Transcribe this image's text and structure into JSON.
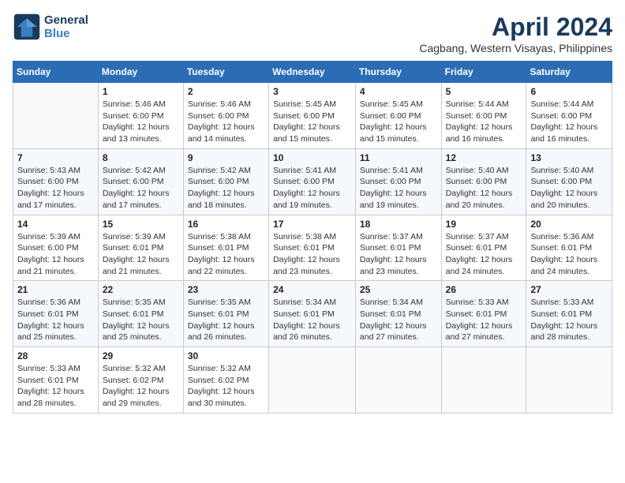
{
  "header": {
    "logo_line1": "General",
    "logo_line2": "Blue",
    "month_year": "April 2024",
    "location": "Cagbang, Western Visayas, Philippines"
  },
  "weekdays": [
    "Sunday",
    "Monday",
    "Tuesday",
    "Wednesday",
    "Thursday",
    "Friday",
    "Saturday"
  ],
  "weeks": [
    [
      {
        "day": "",
        "info": ""
      },
      {
        "day": "1",
        "info": "Sunrise: 5:46 AM\nSunset: 6:00 PM\nDaylight: 12 hours\nand 13 minutes."
      },
      {
        "day": "2",
        "info": "Sunrise: 5:46 AM\nSunset: 6:00 PM\nDaylight: 12 hours\nand 14 minutes."
      },
      {
        "day": "3",
        "info": "Sunrise: 5:45 AM\nSunset: 6:00 PM\nDaylight: 12 hours\nand 15 minutes."
      },
      {
        "day": "4",
        "info": "Sunrise: 5:45 AM\nSunset: 6:00 PM\nDaylight: 12 hours\nand 15 minutes."
      },
      {
        "day": "5",
        "info": "Sunrise: 5:44 AM\nSunset: 6:00 PM\nDaylight: 12 hours\nand 16 minutes."
      },
      {
        "day": "6",
        "info": "Sunrise: 5:44 AM\nSunset: 6:00 PM\nDaylight: 12 hours\nand 16 minutes."
      }
    ],
    [
      {
        "day": "7",
        "info": "Sunrise: 5:43 AM\nSunset: 6:00 PM\nDaylight: 12 hours\nand 17 minutes."
      },
      {
        "day": "8",
        "info": "Sunrise: 5:42 AM\nSunset: 6:00 PM\nDaylight: 12 hours\nand 17 minutes."
      },
      {
        "day": "9",
        "info": "Sunrise: 5:42 AM\nSunset: 6:00 PM\nDaylight: 12 hours\nand 18 minutes."
      },
      {
        "day": "10",
        "info": "Sunrise: 5:41 AM\nSunset: 6:00 PM\nDaylight: 12 hours\nand 19 minutes."
      },
      {
        "day": "11",
        "info": "Sunrise: 5:41 AM\nSunset: 6:00 PM\nDaylight: 12 hours\nand 19 minutes."
      },
      {
        "day": "12",
        "info": "Sunrise: 5:40 AM\nSunset: 6:00 PM\nDaylight: 12 hours\nand 20 minutes."
      },
      {
        "day": "13",
        "info": "Sunrise: 5:40 AM\nSunset: 6:00 PM\nDaylight: 12 hours\nand 20 minutes."
      }
    ],
    [
      {
        "day": "14",
        "info": "Sunrise: 5:39 AM\nSunset: 6:00 PM\nDaylight: 12 hours\nand 21 minutes."
      },
      {
        "day": "15",
        "info": "Sunrise: 5:39 AM\nSunset: 6:01 PM\nDaylight: 12 hours\nand 21 minutes."
      },
      {
        "day": "16",
        "info": "Sunrise: 5:38 AM\nSunset: 6:01 PM\nDaylight: 12 hours\nand 22 minutes."
      },
      {
        "day": "17",
        "info": "Sunrise: 5:38 AM\nSunset: 6:01 PM\nDaylight: 12 hours\nand 23 minutes."
      },
      {
        "day": "18",
        "info": "Sunrise: 5:37 AM\nSunset: 6:01 PM\nDaylight: 12 hours\nand 23 minutes."
      },
      {
        "day": "19",
        "info": "Sunrise: 5:37 AM\nSunset: 6:01 PM\nDaylight: 12 hours\nand 24 minutes."
      },
      {
        "day": "20",
        "info": "Sunrise: 5:36 AM\nSunset: 6:01 PM\nDaylight: 12 hours\nand 24 minutes."
      }
    ],
    [
      {
        "day": "21",
        "info": "Sunrise: 5:36 AM\nSunset: 6:01 PM\nDaylight: 12 hours\nand 25 minutes."
      },
      {
        "day": "22",
        "info": "Sunrise: 5:35 AM\nSunset: 6:01 PM\nDaylight: 12 hours\nand 25 minutes."
      },
      {
        "day": "23",
        "info": "Sunrise: 5:35 AM\nSunset: 6:01 PM\nDaylight: 12 hours\nand 26 minutes."
      },
      {
        "day": "24",
        "info": "Sunrise: 5:34 AM\nSunset: 6:01 PM\nDaylight: 12 hours\nand 26 minutes."
      },
      {
        "day": "25",
        "info": "Sunrise: 5:34 AM\nSunset: 6:01 PM\nDaylight: 12 hours\nand 27 minutes."
      },
      {
        "day": "26",
        "info": "Sunrise: 5:33 AM\nSunset: 6:01 PM\nDaylight: 12 hours\nand 27 minutes."
      },
      {
        "day": "27",
        "info": "Sunrise: 5:33 AM\nSunset: 6:01 PM\nDaylight: 12 hours\nand 28 minutes."
      }
    ],
    [
      {
        "day": "28",
        "info": "Sunrise: 5:33 AM\nSunset: 6:01 PM\nDaylight: 12 hours\nand 28 minutes."
      },
      {
        "day": "29",
        "info": "Sunrise: 5:32 AM\nSunset: 6:02 PM\nDaylight: 12 hours\nand 29 minutes."
      },
      {
        "day": "30",
        "info": "Sunrise: 5:32 AM\nSunset: 6:02 PM\nDaylight: 12 hours\nand 30 minutes."
      },
      {
        "day": "",
        "info": ""
      },
      {
        "day": "",
        "info": ""
      },
      {
        "day": "",
        "info": ""
      },
      {
        "day": "",
        "info": ""
      }
    ]
  ]
}
